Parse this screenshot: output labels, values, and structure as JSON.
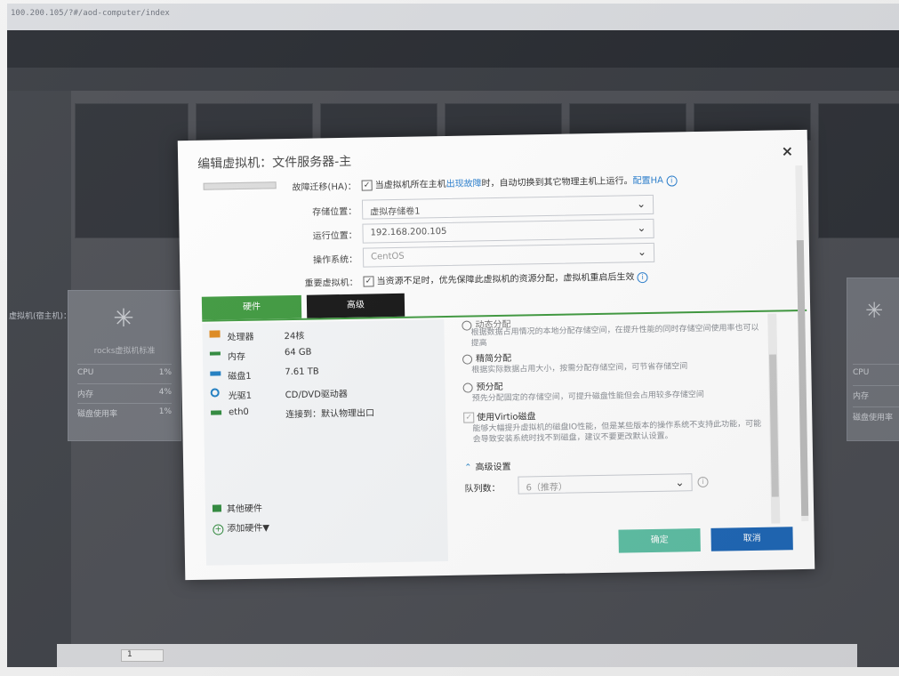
{
  "browser": {
    "url": "100.200.105/?#/aod-computer/index"
  },
  "background": {
    "left_label": "虚拟机(宿主机)：",
    "vm_card": {
      "name": "rocks虚拟机标准",
      "rows": [
        {
          "label": "CPU",
          "value": "1%"
        },
        {
          "label": "内存",
          "value": "4%"
        },
        {
          "label": "磁盘使用率",
          "value": "1%"
        }
      ]
    },
    "vm_card_right": {
      "rows": [
        "CPU",
        "内存",
        "磁盘使用率"
      ]
    },
    "pager_page": "1"
  },
  "dialog": {
    "title": "编辑虚拟机：文件服务器-主",
    "close_label": "×",
    "failover": {
      "label": "故障迁移(HA)：",
      "text_before": "当虚拟机所在主机",
      "text_highlight": "出现故障",
      "text_after": "时，自动切换到其它物理主机上运行。",
      "link": "配置HA"
    },
    "storage": {
      "label": "存储位置：",
      "value": "虚拟存储卷1"
    },
    "run_location": {
      "label": "运行位置：",
      "value": "192.168.200.105"
    },
    "os": {
      "label": "操作系统：",
      "value": "CentOS"
    },
    "important_vm": {
      "label": "重要虚拟机：",
      "text": "当资源不足时，优先保障此虚拟机的资源分配，虚拟机重启后生效"
    },
    "tabs": {
      "hardware": "硬件",
      "advanced": "高级"
    },
    "hardware": [
      {
        "name": "处理器",
        "value": "24核",
        "icon": "cpu-icon",
        "color": "#e08a1e"
      },
      {
        "name": "内存",
        "value": "64 GB",
        "icon": "memory-icon",
        "color": "#2f8a3c"
      },
      {
        "name": "磁盘1",
        "value": "7.61 TB",
        "icon": "disk-icon",
        "color": "#1f7fc4"
      },
      {
        "name": "光驱1",
        "value": "CD/DVD驱动器",
        "icon": "cdrom-icon",
        "color": "#1f7fc4"
      },
      {
        "name": "eth0",
        "value": "连接到：默认物理出口",
        "icon": "network-icon",
        "color": "#2f8a3c"
      }
    ],
    "other_hardware": "其他硬件",
    "add_hardware": "添加硬件▼",
    "alloc": {
      "dynamic_label": "动态分配",
      "dynamic_desc": "根据数据占用情况的本地分配存储空间，在提升性能的同时存储空间使用率也可以提高",
      "thin_label": "精简分配",
      "thin_desc": "根据实际数据占用大小，按需分配存储空间，可节省存储空间",
      "pre_label": "预分配",
      "pre_desc": "预先分配固定的存储空间，可提升磁盘性能但会占用较多存储空间",
      "virtio_label": "使用Virtio磁盘",
      "virtio_desc": "能够大幅提升虚拟机的磁盘IO性能，但是某些版本的操作系统不支持此功能，可能会导致安装系统时找不到磁盘，建议不要更改默认设置。",
      "advanced_settings": "高级设置",
      "queue_label": "队列数：",
      "queue_value": "6（推荐）"
    },
    "ok_label": "确定",
    "cancel_label": "取消"
  }
}
